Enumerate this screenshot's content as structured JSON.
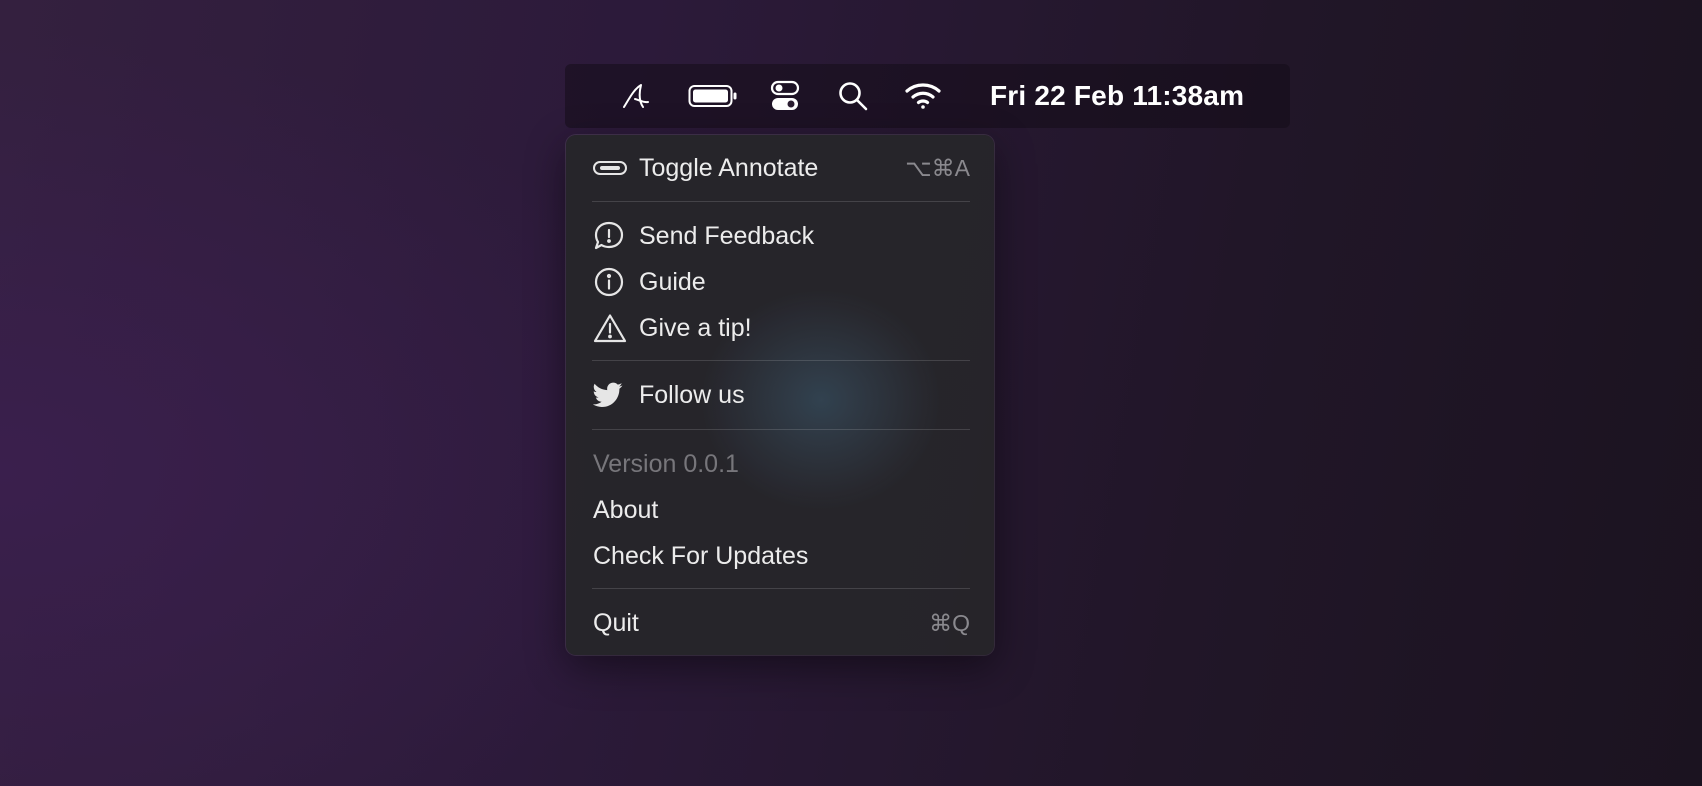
{
  "menubar": {
    "icons": [
      {
        "name": "annotate-app-icon"
      },
      {
        "name": "battery-icon"
      },
      {
        "name": "control-center-icon"
      },
      {
        "name": "spotlight-search-icon"
      },
      {
        "name": "wifi-icon"
      }
    ],
    "clock": "Fri 22 Feb 11:38am"
  },
  "menu": {
    "toggle_annotate": {
      "label": "Toggle Annotate",
      "shortcut": "⌥⌘A",
      "icon": "toggle-icon"
    },
    "send_feedback": {
      "label": "Send Feedback",
      "icon": "feedback-bubble-icon"
    },
    "guide": {
      "label": "Guide",
      "icon": "info-circle-icon"
    },
    "give_tip": {
      "label": "Give a tip!",
      "icon": "warning-triangle-icon"
    },
    "follow_us": {
      "label": "Follow us",
      "icon": "twitter-bird-icon"
    },
    "version": {
      "label": "Version 0.0.1"
    },
    "about": {
      "label": "About"
    },
    "check_updates": {
      "label": "Check For Updates"
    },
    "quit": {
      "label": "Quit",
      "shortcut": "⌘Q"
    }
  },
  "colors": {
    "menu_background": "#26252a",
    "menu_text": "#ececec",
    "disabled_text": "#77767b",
    "shortcut_text": "#8a898e"
  }
}
